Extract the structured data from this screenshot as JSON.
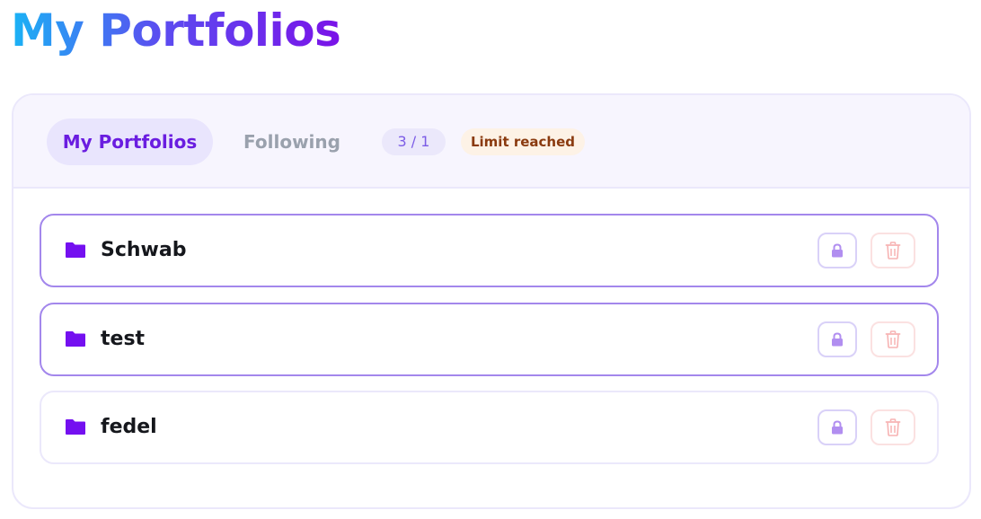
{
  "page": {
    "title": "My Portfolios"
  },
  "tabs": [
    {
      "label": "My Portfolios",
      "active": true
    },
    {
      "label": "Following",
      "active": false
    }
  ],
  "badges": {
    "count": "3 / 1",
    "limit": "Limit reached"
  },
  "portfolios": [
    {
      "name": "Schwab",
      "icon": "folder-icon",
      "lock_icon": "lock-icon",
      "delete_icon": "trash-icon"
    },
    {
      "name": "test",
      "icon": "folder-icon",
      "lock_icon": "lock-icon",
      "delete_icon": "trash-icon"
    },
    {
      "name": "fedel",
      "icon": "folder-icon",
      "lock_icon": "lock-icon",
      "delete_icon": "trash-icon"
    }
  ],
  "colors": {
    "accent": "#6a1de0",
    "folder": "#7410f0",
    "lock": "#b18ef0",
    "trash": "#f7b3b3",
    "card_border_active": "#a387ec",
    "card_border": "#ebe8fb"
  }
}
